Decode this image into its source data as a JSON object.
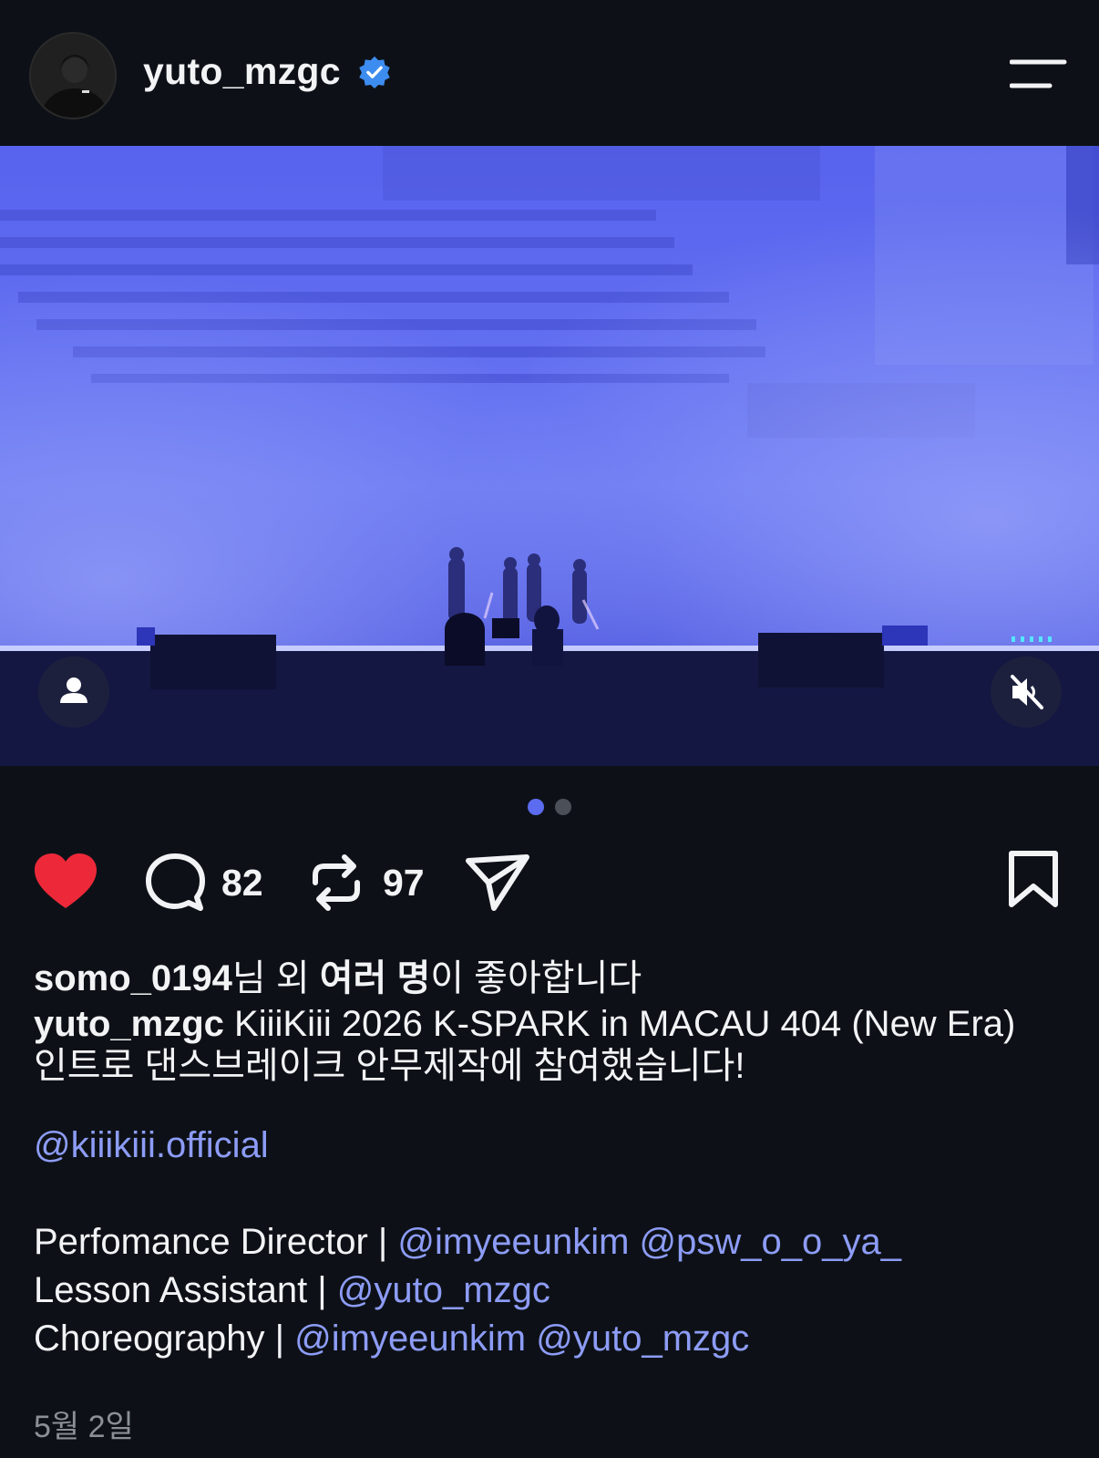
{
  "header": {
    "username": "yuto_mzgc",
    "verified_icon": "verified-badge-icon",
    "menu_icon": "hamburger-menu-icon"
  },
  "media": {
    "tag_icon": "person-icon",
    "mute_icon": "muted-speaker-icon",
    "page_count": 2,
    "active_page": 1
  },
  "actions": {
    "like_icon": "heart-filled-icon",
    "comment_icon": "comment-bubble-icon",
    "comment_count": "82",
    "repost_icon": "repost-icon",
    "repost_count": "97",
    "share_icon": "send-icon",
    "save_icon": "bookmark-icon",
    "like_color": "#ed2939"
  },
  "likes": {
    "user": "somo_0194",
    "text_middle": "님 외 ",
    "text_bold": "여러 명",
    "text_end": "이 좋아합니다"
  },
  "caption": {
    "author": "yuto_mzgc",
    "text": " KiiiKiii 2026 K-SPARK in MACAU 404 (New Era) 인트로 댄스브레이크 안무제작에 참여했습니다!",
    "mention_official": "@kiiikiii.official",
    "credits": [
      {
        "label": "Perfomance Director | ",
        "mentions": "@imyeeunkim @psw_o_o_ya_"
      },
      {
        "label": "Lesson Assistant | ",
        "mentions": "@yuto_mzgc"
      },
      {
        "label": "Choreography | ",
        "mentions": "@imyeeunkim @yuto_mzgc"
      }
    ]
  },
  "date": "5월 2일",
  "colors": {
    "background": "#0d1117",
    "mention": "#8d9cf6",
    "accent_dot": "#5b6cf0"
  }
}
